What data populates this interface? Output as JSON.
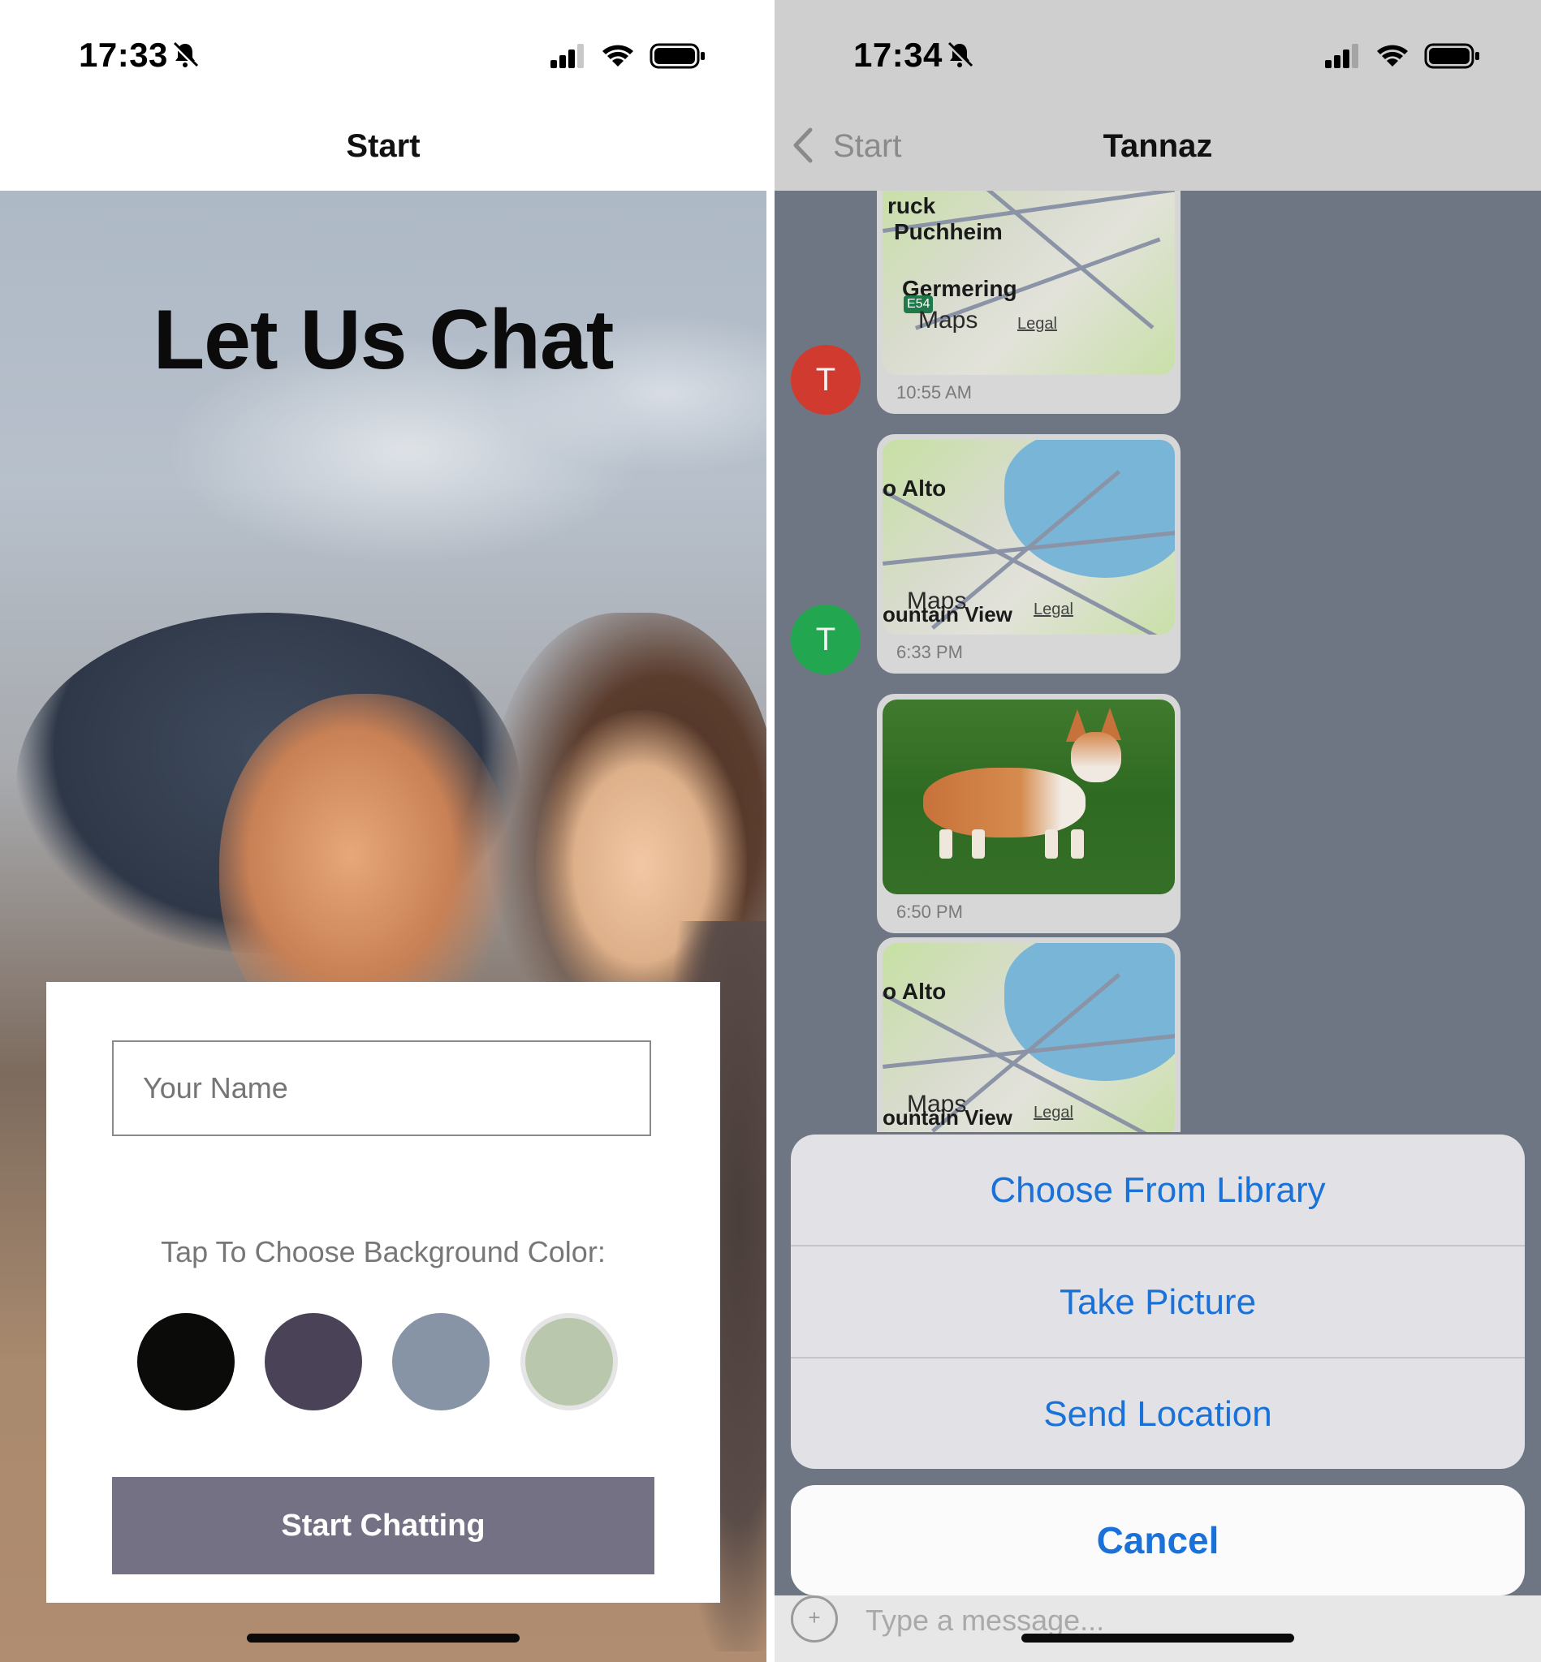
{
  "left": {
    "status": {
      "time": "17:33"
    },
    "nav": {
      "title": "Start"
    },
    "hero_title": "Let Us Chat",
    "form": {
      "name_placeholder": "Your Name",
      "color_label": "Tap To Choose Background Color:",
      "colors": [
        "#0b0c0a",
        "#4a4358",
        "#8794a6",
        "#b9c8ad"
      ],
      "start_button": "Start Chatting"
    }
  },
  "right": {
    "status": {
      "time": "17:34"
    },
    "nav": {
      "back_label": "Start",
      "title": "Tannaz"
    },
    "messages": [
      {
        "avatar": "T",
        "avatar_color": "#d13b2f",
        "type": "map",
        "city": "Puchheim",
        "city2": "Germering",
        "city_top": "ruck",
        "time": "10:55 AM"
      },
      {
        "avatar": "T",
        "avatar_color": "#22a650",
        "type": "map",
        "city": "o Alto",
        "city2": "ountain View",
        "time": "6:33 PM"
      },
      {
        "type": "image",
        "subject": "corgi dog on grass",
        "time": "6:50 PM"
      },
      {
        "type": "map",
        "city": "o Alto",
        "city2": "ountain View"
      }
    ],
    "map_labels": {
      "maps": "Maps",
      "legal": "Legal",
      "highway": "E54"
    },
    "action_sheet": [
      "Choose From Library",
      "Take Picture",
      "Send Location"
    ],
    "cancel": "Cancel",
    "composer": {
      "placeholder": "Type a message..."
    }
  }
}
